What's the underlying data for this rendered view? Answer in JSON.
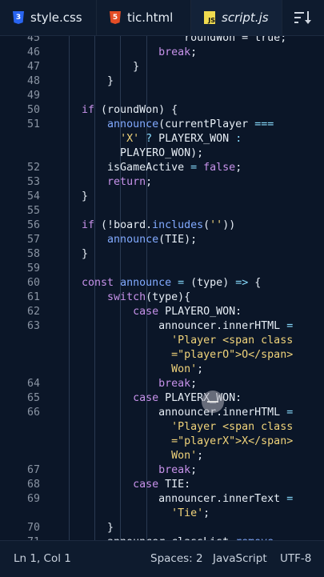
{
  "tabs": [
    {
      "label": "style.css",
      "icon": "css3-icon",
      "color": "#2965f1",
      "badge": "3"
    },
    {
      "label": "tic.html",
      "icon": "html5-icon",
      "color": "#e44d26",
      "badge": "5"
    },
    {
      "label": "script.js",
      "icon": "js-icon",
      "color": "#f0db4f",
      "badge": "JS",
      "active": true
    }
  ],
  "code_lines": [
    {
      "n": "45",
      "t": [
        [
          "pl",
          "                    roundWon = true;"
        ]
      ]
    },
    {
      "n": "46",
      "t": [
        [
          "pl",
          "                "
        ],
        [
          "kw",
          "break"
        ],
        [
          "pl",
          ";"
        ]
      ]
    },
    {
      "n": "47",
      "t": [
        [
          "pl",
          "            }"
        ]
      ]
    },
    {
      "n": "48",
      "t": [
        [
          "pl",
          "        }"
        ]
      ]
    },
    {
      "n": "49",
      "t": []
    },
    {
      "n": "50",
      "t": [
        [
          "pl",
          "    "
        ],
        [
          "kw",
          "if"
        ],
        [
          "pl",
          " (roundWon) {"
        ]
      ]
    },
    {
      "n": "51",
      "t": [
        [
          "pl",
          "        "
        ],
        [
          "fn",
          "announce"
        ],
        [
          "pl",
          "(currentPlayer "
        ],
        [
          "op",
          "==="
        ]
      ]
    },
    {
      "n": "",
      "t": [
        [
          "pl",
          "          "
        ],
        [
          "str",
          "'X'"
        ],
        [
          "pl",
          " "
        ],
        [
          "op",
          "?"
        ],
        [
          "pl",
          " PLAYERX_WON "
        ],
        [
          "op",
          ":"
        ]
      ]
    },
    {
      "n": "",
      "t": [
        [
          "pl",
          "          PLAYERO_WON);"
        ]
      ]
    },
    {
      "n": "52",
      "t": [
        [
          "pl",
          "        isGameActive "
        ],
        [
          "op",
          "="
        ],
        [
          "pl",
          " "
        ],
        [
          "kw",
          "false"
        ],
        [
          "pl",
          ";"
        ]
      ]
    },
    {
      "n": "53",
      "t": [
        [
          "pl",
          "        "
        ],
        [
          "kw",
          "return"
        ],
        [
          "pl",
          ";"
        ]
      ]
    },
    {
      "n": "54",
      "t": [
        [
          "pl",
          "    }"
        ]
      ]
    },
    {
      "n": "55",
      "t": []
    },
    {
      "n": "56",
      "t": [
        [
          "pl",
          "    "
        ],
        [
          "kw",
          "if"
        ],
        [
          "pl",
          " (!board."
        ],
        [
          "fn",
          "includes"
        ],
        [
          "pl",
          "("
        ],
        [
          "str",
          "''"
        ],
        [
          "pl",
          "))"
        ]
      ]
    },
    {
      "n": "57",
      "t": [
        [
          "pl",
          "        "
        ],
        [
          "fn",
          "announce"
        ],
        [
          "pl",
          "(TIE);"
        ]
      ]
    },
    {
      "n": "58",
      "t": [
        [
          "pl",
          "    }"
        ]
      ]
    },
    {
      "n": "59",
      "t": []
    },
    {
      "n": "60",
      "t": [
        [
          "kw",
          "    const"
        ],
        [
          "pl",
          " "
        ],
        [
          "fn",
          "announce"
        ],
        [
          "pl",
          " "
        ],
        [
          "op",
          "="
        ],
        [
          "pl",
          " (type) "
        ],
        [
          "op",
          "=>"
        ],
        [
          "pl",
          " {"
        ]
      ]
    },
    {
      "n": "61",
      "t": [
        [
          "pl",
          "        "
        ],
        [
          "kw",
          "switch"
        ],
        [
          "pl",
          "(type){"
        ]
      ]
    },
    {
      "n": "62",
      "t": [
        [
          "pl",
          "            "
        ],
        [
          "kw",
          "case"
        ],
        [
          "pl",
          " PLAYERO_WON:"
        ]
      ]
    },
    {
      "n": "63",
      "t": [
        [
          "pl",
          "                announcer.innerHTML "
        ],
        [
          "op",
          "="
        ]
      ]
    },
    {
      "n": "",
      "t": [
        [
          "str",
          "                  'Player <span class"
        ]
      ]
    },
    {
      "n": "",
      "t": [
        [
          "str",
          "                  =\"playerO\">O</span>"
        ]
      ]
    },
    {
      "n": "",
      "t": [
        [
          "str",
          "                  Won'"
        ],
        [
          "pl",
          ";"
        ]
      ]
    },
    {
      "n": "64",
      "t": [
        [
          "pl",
          "                "
        ],
        [
          "kw",
          "break"
        ],
        [
          "pl",
          ";"
        ]
      ]
    },
    {
      "n": "65",
      "t": [
        [
          "pl",
          "            "
        ],
        [
          "kw",
          "case"
        ],
        [
          "pl",
          " PLAYERX_WON:"
        ]
      ]
    },
    {
      "n": "66",
      "t": [
        [
          "pl",
          "                announcer.innerHTML "
        ],
        [
          "op",
          "="
        ]
      ]
    },
    {
      "n": "",
      "t": [
        [
          "str",
          "                  'Player <span class"
        ]
      ]
    },
    {
      "n": "",
      "t": [
        [
          "str",
          "                  =\"playerX\">X</span>"
        ]
      ]
    },
    {
      "n": "",
      "t": [
        [
          "str",
          "                  Won'"
        ],
        [
          "pl",
          ";"
        ]
      ]
    },
    {
      "n": "67",
      "t": [
        [
          "pl",
          "                "
        ],
        [
          "kw",
          "break"
        ],
        [
          "pl",
          ";"
        ]
      ]
    },
    {
      "n": "68",
      "t": [
        [
          "pl",
          "            "
        ],
        [
          "kw",
          "case"
        ],
        [
          "pl",
          " TIE:"
        ]
      ]
    },
    {
      "n": "69",
      "t": [
        [
          "pl",
          "                announcer.innerText "
        ],
        [
          "op",
          "="
        ]
      ]
    },
    {
      "n": "",
      "t": [
        [
          "str",
          "                  'Tie'"
        ],
        [
          "pl",
          ";"
        ]
      ]
    },
    {
      "n": "70",
      "t": [
        [
          "pl",
          "        }"
        ]
      ]
    },
    {
      "n": "71",
      "t": [
        [
          "pl",
          "        announcer.classList."
        ],
        [
          "fn",
          "remove"
        ]
      ]
    }
  ],
  "status": {
    "position": "Ln 1, Col 1",
    "spaces": "Spaces: 2",
    "language": "JavaScript",
    "encoding": "UTF-8"
  }
}
